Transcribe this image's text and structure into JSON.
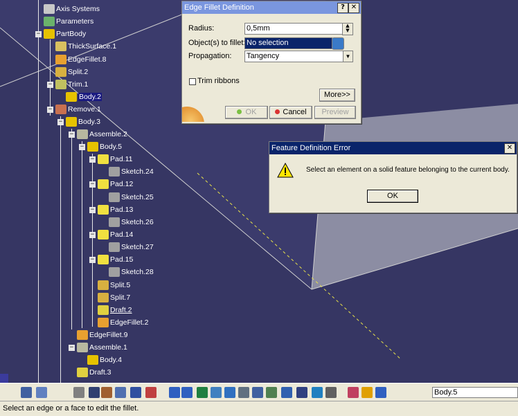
{
  "tree": {
    "nodes": [
      {
        "label": "Axis Systems",
        "icon": "axis-icon"
      },
      {
        "label": "Parameters",
        "icon": "parameters-icon"
      },
      {
        "label": "PartBody",
        "icon": "body-icon"
      },
      {
        "label": "ThickSurface.1",
        "icon": "thick-surface-icon"
      },
      {
        "label": "EdgeFillet.8",
        "icon": "edge-fillet-icon"
      },
      {
        "label": "Split.2",
        "icon": "split-icon"
      },
      {
        "label": "Trim.1",
        "icon": "trim-icon"
      },
      {
        "label": "Body.2",
        "icon": "body-icon"
      },
      {
        "label": "Remove.1",
        "icon": "remove-icon"
      },
      {
        "label": "Body.3",
        "icon": "body-icon"
      },
      {
        "label": "Assemble.2",
        "icon": "assemble-icon"
      },
      {
        "label": "Body.5",
        "icon": "body-icon"
      },
      {
        "label": "Pad.11",
        "icon": "pad-icon"
      },
      {
        "label": "Sketch.24",
        "icon": "sketch-icon"
      },
      {
        "label": "Pad.12",
        "icon": "pad-icon"
      },
      {
        "label": "Sketch.25",
        "icon": "sketch-icon"
      },
      {
        "label": "Pad.13",
        "icon": "pad-icon"
      },
      {
        "label": "Sketch.26",
        "icon": "sketch-icon"
      },
      {
        "label": "Pad.14",
        "icon": "pad-icon"
      },
      {
        "label": "Sketch.27",
        "icon": "sketch-icon"
      },
      {
        "label": "Pad.15",
        "icon": "pad-icon"
      },
      {
        "label": "Sketch.28",
        "icon": "sketch-icon"
      },
      {
        "label": "Split.5",
        "icon": "split-icon"
      },
      {
        "label": "Split.7",
        "icon": "split-icon"
      },
      {
        "label": "Draft.2",
        "icon": "draft-icon"
      },
      {
        "label": "EdgeFillet.2",
        "icon": "edge-fillet-icon"
      },
      {
        "label": "EdgeFillet.9",
        "icon": "edge-fillet-icon"
      },
      {
        "label": "Assemble.1",
        "icon": "assemble-icon"
      },
      {
        "label": "Body.4",
        "icon": "body-icon"
      },
      {
        "label": "Draft.3",
        "icon": "draft-icon"
      }
    ]
  },
  "fillet_dialog": {
    "title": "Edge Fillet Definition",
    "help_button": "?",
    "close_button": "✕",
    "radius_label": "Radius:",
    "radius_value": "0,5mm",
    "objects_label": "Object(s) to fillet:",
    "objects_value": "No selection",
    "propagation_label": "Propagation:",
    "propagation_value": "Tangency",
    "trim_ribbons_label": "Trim ribbons",
    "more_button": "More>>",
    "ok_button": "OK",
    "cancel_button": "Cancel",
    "preview_button": "Preview"
  },
  "error_dialog": {
    "title": "Feature Definition Error",
    "close_button": "✕",
    "message": "Select an element on a solid feature belonging to the current body.",
    "ok_button": "OK"
  },
  "toolbar": {
    "current_body": "Body.5"
  },
  "status": {
    "text": "Select an edge or a face to edit the fillet."
  },
  "colors": {
    "background": "#363663",
    "title_active": "#0a246a",
    "title_inactive": "#7a96df",
    "highlight": "#1a1a80"
  }
}
